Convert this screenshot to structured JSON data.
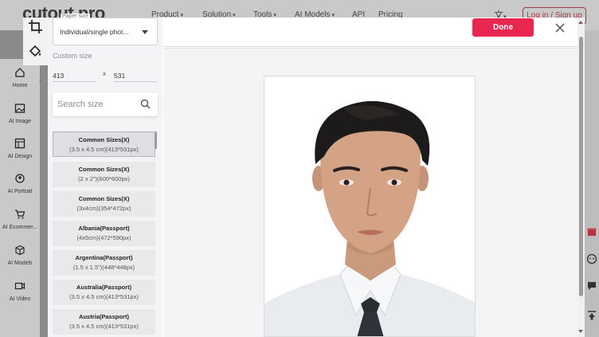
{
  "site": {
    "logo": "cutout.pro",
    "nav": [
      "Product",
      "Solution",
      "Tools",
      "AI Models",
      "API",
      "Pricing"
    ],
    "nav_has_dropdown": [
      true,
      true,
      true,
      true,
      false,
      false
    ],
    "lang_icon": "translate-icon",
    "login_label": "Log in / Sign up"
  },
  "left_rail": [
    {
      "label": "Home",
      "icon": "home-icon"
    },
    {
      "label": "AI Image",
      "icon": "image-icon"
    },
    {
      "label": "AI Design",
      "icon": "design-icon"
    },
    {
      "label": "AI Portrait",
      "icon": "portrait-icon"
    },
    {
      "label": "AI Ecommer...",
      "icon": "cart-icon"
    },
    {
      "label": "AI Models",
      "icon": "cube-icon"
    },
    {
      "label": "AI Video",
      "icon": "video-icon"
    }
  ],
  "editor": {
    "tools": [
      "crop-icon",
      "fill-bucket-icon"
    ],
    "paper_size": {
      "legend": "Paper size",
      "value": "Individual/single phot..."
    },
    "custom_size_label": "Custom size",
    "width": "413",
    "height": "531",
    "times_sign": "x",
    "search_placeholder": "Search size",
    "sizes": [
      {
        "title": "Common Sizes(X)",
        "desc": "(3.5 x 4.5 cm)(413*531px)",
        "selected": true
      },
      {
        "title": "Common Sizes(X)",
        "desc": "(2 x 2\")(600*600px)",
        "selected": false
      },
      {
        "title": "Common Sizes(X)",
        "desc": "(3x4cm)(354*472px)",
        "selected": false
      },
      {
        "title": "Albania(Passport)",
        "desc": "(4x5cm)(472*590px)",
        "selected": false
      },
      {
        "title": "Argentina(Passport)",
        "desc": "(1.5 x 1.5\")(448*448px)",
        "selected": false
      },
      {
        "title": "Australia(Passport)",
        "desc": "(3.5 x 4.5 cm)(413*531px)",
        "selected": false
      },
      {
        "title": "Austria(Passport)",
        "desc": "(3.5 x 4.5 cm)(413*531px)",
        "selected": false
      }
    ],
    "done_label": "Done",
    "colors": {
      "accent": "#e8264f",
      "panel": "#f4f4f6"
    }
  }
}
